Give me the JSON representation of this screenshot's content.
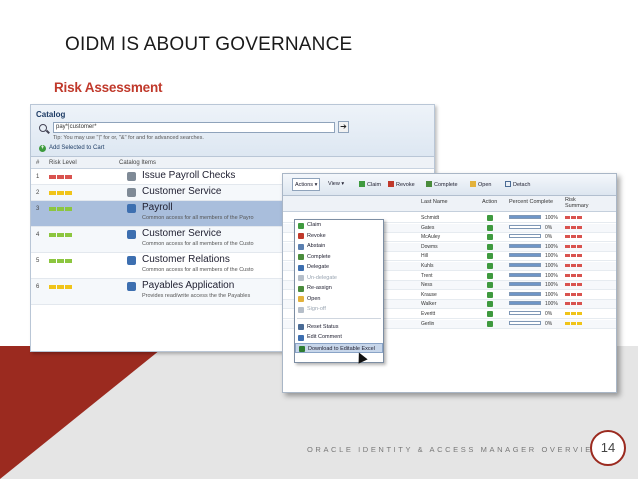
{
  "slide": {
    "title": "OIDM IS ABOUT GOVERNANCE",
    "subtitle": "Risk Assessment",
    "footer": "ORACLE IDENTITY & ACCESS MANAGER OVERVIEW",
    "page_number": "14"
  },
  "colors": {
    "accent": "#9b2a1f",
    "subtitle": "#c0392b",
    "risk_high": "#d9534f",
    "risk_medium": "#f0c419",
    "risk_low": "#8cc63f"
  },
  "catalog": {
    "title": "Catalog",
    "search_value": "pay*|customer*",
    "tip": "Tip: You may use \"|\" for or, \"&\" for and for advanced searches.",
    "add_to_cart": "Add Selected to Cart",
    "columns": [
      "#",
      "Risk Level",
      "Catalog Items"
    ],
    "rows": [
      {
        "num": "1",
        "risk": "high",
        "name": "Issue Payroll Checks",
        "desc": ""
      },
      {
        "num": "2",
        "risk": "medium",
        "name": "Customer Service",
        "desc": ""
      },
      {
        "num": "3",
        "risk": "low",
        "name": "Payroll",
        "desc": "Common access for all members of the Payro"
      },
      {
        "num": "4",
        "risk": "low",
        "name": "Customer Service",
        "desc": "Common access for all members of the Custo"
      },
      {
        "num": "5",
        "risk": "low",
        "name": "Customer Relations",
        "desc": "Common access for all members of the Custo"
      },
      {
        "num": "6",
        "risk": "medium",
        "name": "Payables Application",
        "desc": "Provides read/write access the the Payables"
      }
    ]
  },
  "toolbar": {
    "actions": "Actions",
    "view": "View",
    "claim": "Claim",
    "revoke": "Revoke",
    "complete": "Complete",
    "open": "Open",
    "detach": "Detach"
  },
  "grid": {
    "columns": {
      "last_name": "Last Name",
      "action": "Action",
      "percent": "Percent Complete",
      "risk": "Risk Summary"
    },
    "rows": [
      {
        "name": "Schmidt",
        "pct": "100%",
        "fill": 1.0,
        "risk": "high"
      },
      {
        "name": "Gates",
        "pct": "0%",
        "fill": 0.0,
        "risk": "high"
      },
      {
        "name": "McAuley",
        "pct": "0%",
        "fill": 0.0,
        "risk": "high"
      },
      {
        "name": "Dowms",
        "pct": "100%",
        "fill": 1.0,
        "risk": "high"
      },
      {
        "name": "Hill",
        "pct": "100%",
        "fill": 1.0,
        "risk": "high"
      },
      {
        "name": "Kuhls",
        "pct": "100%",
        "fill": 1.0,
        "risk": "high"
      },
      {
        "name": "Trent",
        "pct": "100%",
        "fill": 1.0,
        "risk": "high"
      },
      {
        "name": "Ness",
        "pct": "100%",
        "fill": 1.0,
        "risk": "high"
      },
      {
        "name": "Krause",
        "pct": "100%",
        "fill": 1.0,
        "risk": "high"
      },
      {
        "name": "Walker",
        "pct": "100%",
        "fill": 1.0,
        "risk": "high"
      },
      {
        "name": "Everitt",
        "pct": "0%",
        "fill": 0.0,
        "risk": "medium"
      },
      {
        "name": "Gerlin",
        "pct": "0%",
        "fill": 0.0,
        "risk": "medium"
      }
    ]
  },
  "menu": {
    "items": [
      {
        "label": "Claim",
        "icon": "claim-icon",
        "state": "normal"
      },
      {
        "label": "Revoke",
        "icon": "revoke-icon",
        "state": "normal"
      },
      {
        "label": "Abstain",
        "icon": "abstain-icon",
        "state": "normal"
      },
      {
        "label": "Complete",
        "icon": "complete-icon",
        "state": "normal"
      },
      {
        "label": "Delegate",
        "icon": "delegate-icon",
        "state": "normal"
      },
      {
        "label": "Un-delegate",
        "icon": "undelegate-icon",
        "state": "disabled"
      },
      {
        "label": "Re-assign",
        "icon": "reassign-icon",
        "state": "normal"
      },
      {
        "label": "Open",
        "icon": "open-icon",
        "state": "normal"
      },
      {
        "label": "Sign-off",
        "icon": "signoff-icon",
        "state": "disabled"
      },
      {
        "label": "Reset Status",
        "icon": "reset-icon",
        "state": "normal"
      },
      {
        "label": "Edit Comment",
        "icon": "comment-icon",
        "state": "normal"
      },
      {
        "label": "Download to Editable Excel",
        "icon": "excel-icon",
        "state": "highlighted"
      }
    ]
  }
}
